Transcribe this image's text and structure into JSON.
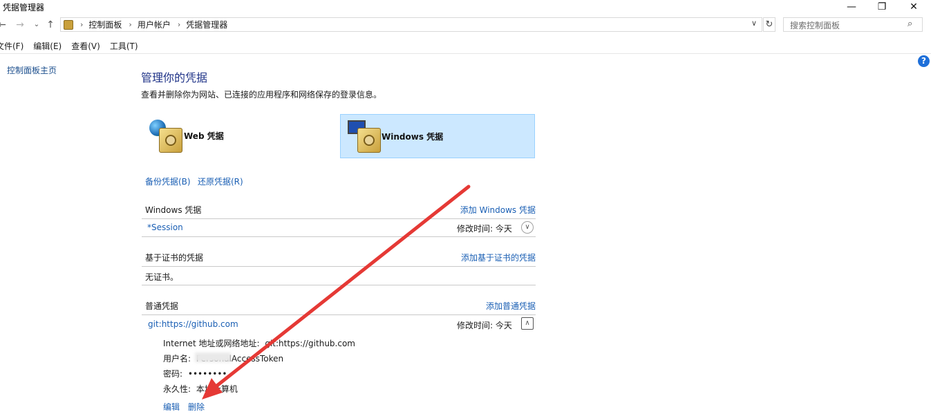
{
  "window": {
    "title": "凭据管理器",
    "minimize_glyph": "—",
    "maximize_glyph": "❐",
    "close_glyph": "✕"
  },
  "address_bar": {
    "breadcrumb": [
      "控制面板",
      "用户帐户",
      "凭据管理器"
    ],
    "search_placeholder": "搜索控制面板"
  },
  "menu": [
    "文件(F)",
    "编辑(E)",
    "查看(V)",
    "工具(T)"
  ],
  "sidebar": {
    "home_link": "控制面板主页"
  },
  "main": {
    "heading": "管理你的凭据",
    "description": "查看并删除你为网站、已连接的应用程序和网络保存的登录信息。",
    "tiles": [
      {
        "label": "Web 凭据",
        "selected": false
      },
      {
        "label": "Windows 凭据",
        "selected": true
      }
    ],
    "backup_link": "备份凭据(B)",
    "restore_link": "还原凭据(R)",
    "sections": {
      "windows": {
        "title": "Windows 凭据",
        "add_link": "添加 Windows 凭据",
        "entry": {
          "name": "*Session",
          "modified": "修改时间:  今天"
        }
      },
      "certificate": {
        "title": "基于证书的凭据",
        "add_link": "添加基于证书的凭据",
        "empty_text": "无证书。"
      },
      "generic": {
        "title": "普通凭据",
        "add_link": "添加普通凭据",
        "entry": {
          "name": "git:https://github.com",
          "modified": "修改时间:  今天",
          "address_label": "Internet 地址或网络地址:",
          "address_value": "git:https://github.com",
          "username_label": "用户名:",
          "username_value": "PersonalAccessToken",
          "password_label": "密码:",
          "password_value": "••••••••",
          "persistence_label": "永久性:",
          "persistence_value": "本地计算机",
          "edit_link": "编辑",
          "delete_link": "删除"
        }
      }
    }
  },
  "colors": {
    "link": "#1a5fb4",
    "heading": "#1e3287",
    "selected_tile": "#cce8ff",
    "annotation_arrow": "#e53935"
  }
}
